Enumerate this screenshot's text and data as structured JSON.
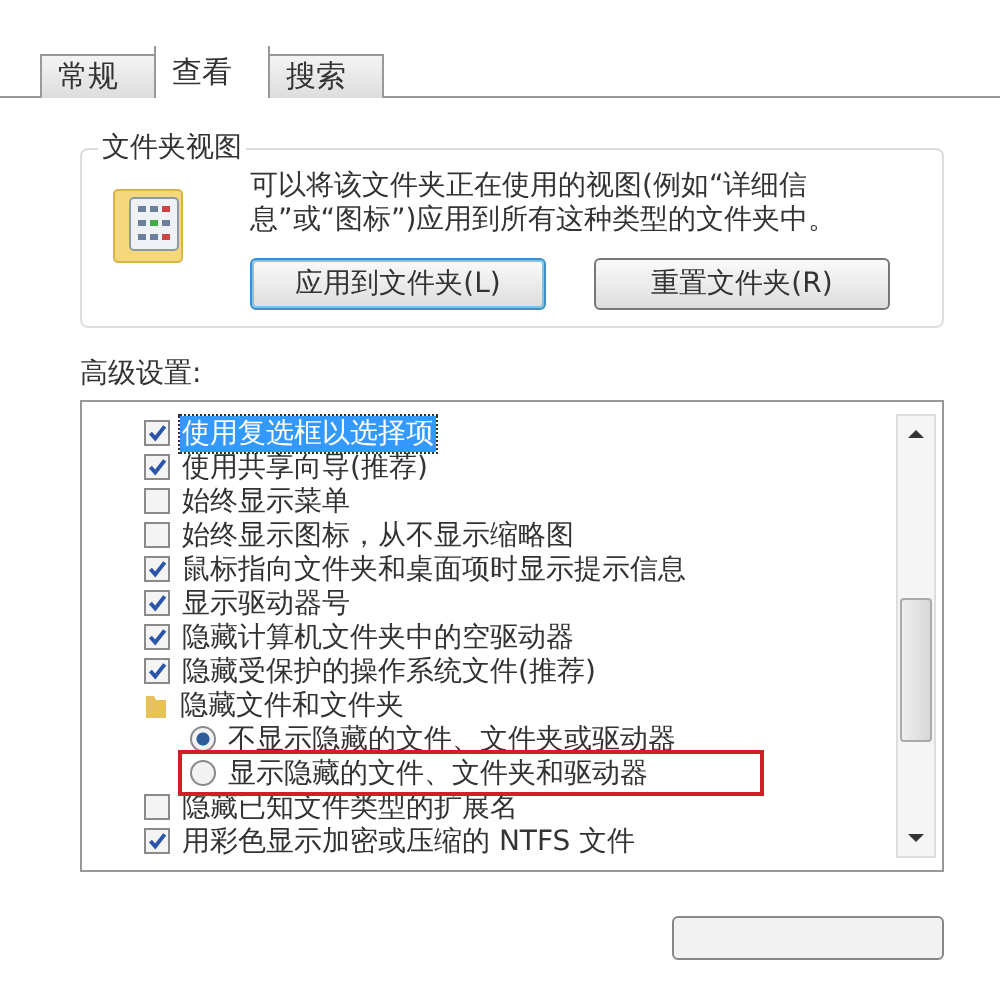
{
  "tabs": [
    {
      "label": "常规",
      "selected": false
    },
    {
      "label": "查看",
      "selected": true
    },
    {
      "label": "搜索",
      "selected": false
    }
  ],
  "folder_views": {
    "title": "文件夹视图",
    "description": "可以将该文件夹正在使用的视图(例如“详细信息”或“图标”)应用到所有这种类型的文件夹中。",
    "buttons": [
      {
        "label": "应用到文件夹(L)",
        "selected": true
      },
      {
        "label": "重置文件夹(R)",
        "selected": false
      }
    ]
  },
  "advanced": {
    "label": "高级设置:",
    "items": [
      {
        "kind": "checkbox",
        "label": "使用复选框以选择项",
        "checked": true,
        "selected": true,
        "highlighted": false
      },
      {
        "kind": "checkbox",
        "label": "使用共享向导(推荐)",
        "checked": true,
        "selected": false,
        "highlighted": false
      },
      {
        "kind": "checkbox",
        "label": "始终显示菜单",
        "checked": false,
        "selected": false,
        "highlighted": false
      },
      {
        "kind": "checkbox",
        "label": "始终显示图标，从不显示缩略图",
        "checked": false,
        "selected": false,
        "highlighted": false
      },
      {
        "kind": "checkbox",
        "label": "鼠标指向文件夹和桌面项时显示提示信息",
        "checked": true,
        "selected": false,
        "highlighted": false
      },
      {
        "kind": "checkbox",
        "label": "显示驱动器号",
        "checked": true,
        "selected": false,
        "highlighted": false
      },
      {
        "kind": "checkbox",
        "label": "隐藏计算机文件夹中的空驱动器",
        "checked": true,
        "selected": false,
        "highlighted": false
      },
      {
        "kind": "checkbox",
        "label": "隐藏受保护的操作系统文件(推荐)",
        "checked": true,
        "selected": false,
        "highlighted": false
      },
      {
        "kind": "folder",
        "label": "隐藏文件和文件夹",
        "selected": false,
        "highlighted": false
      },
      {
        "kind": "radio",
        "label": "不显示隐藏的文件、文件夹或驱动器",
        "checked": true,
        "selected": false,
        "highlighted": false
      },
      {
        "kind": "radio",
        "label": "显示隐藏的文件、文件夹和驱动器",
        "checked": false,
        "selected": false,
        "highlighted": true
      },
      {
        "kind": "checkbox",
        "label": "隐藏已知文件类型的扩展名",
        "checked": false,
        "selected": false,
        "highlighted": false
      },
      {
        "kind": "checkbox",
        "label": "用彩色显示加密或压缩的 NTFS 文件",
        "checked": true,
        "selected": false,
        "highlighted": false
      }
    ]
  }
}
